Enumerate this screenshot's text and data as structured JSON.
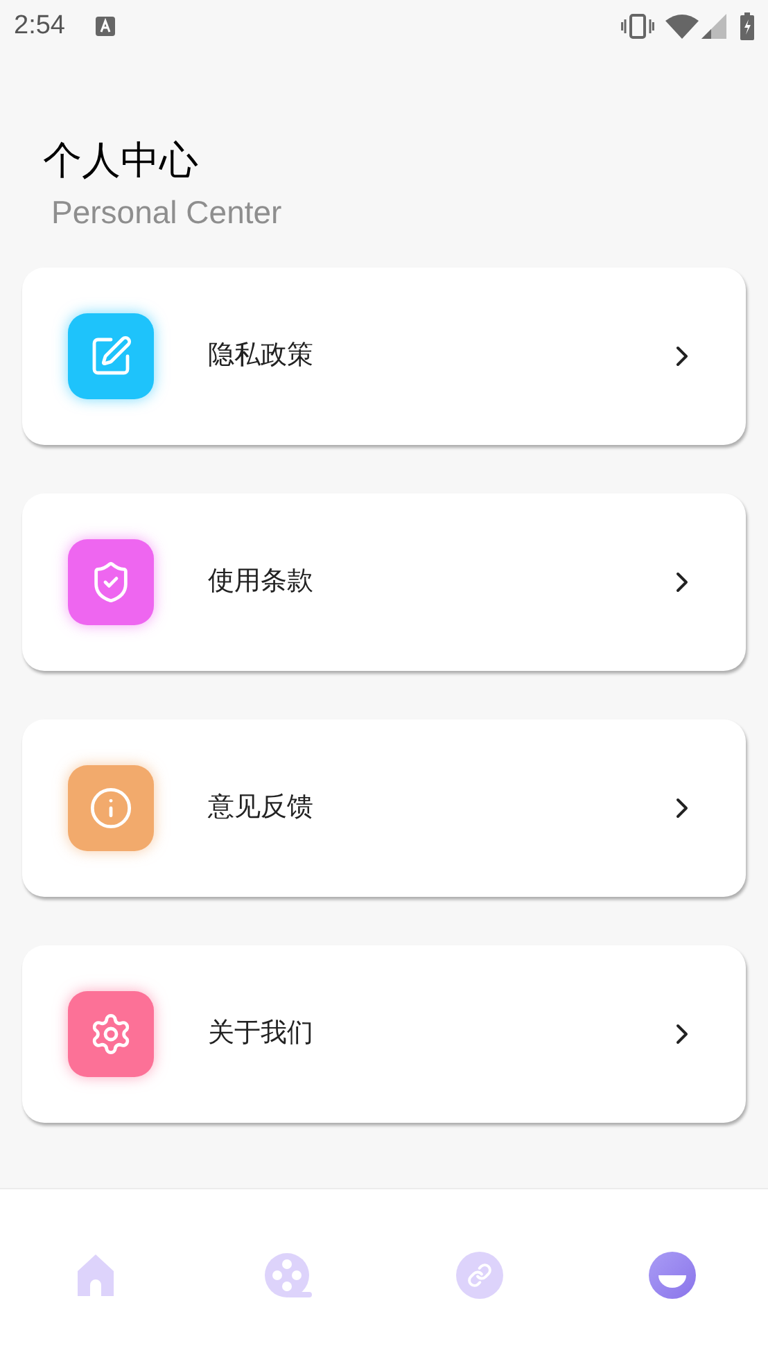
{
  "status_bar": {
    "time": "2:54"
  },
  "header": {
    "title": "个人中心",
    "subtitle": "Personal Center"
  },
  "menu": [
    {
      "label": "隐私政策",
      "kind": "edit",
      "color": "#1ec3fb"
    },
    {
      "label": "使用条款",
      "kind": "shield",
      "color": "#ee66f0"
    },
    {
      "label": "意见反馈",
      "kind": "info",
      "color": "#f2aa6c"
    },
    {
      "label": "关于我们",
      "kind": "gear",
      "color": "#fc7197"
    }
  ],
  "nav": [
    {
      "kind": "home",
      "selected": false
    },
    {
      "kind": "film",
      "selected": false
    },
    {
      "kind": "link",
      "selected": false
    },
    {
      "kind": "profile",
      "selected": true
    }
  ]
}
